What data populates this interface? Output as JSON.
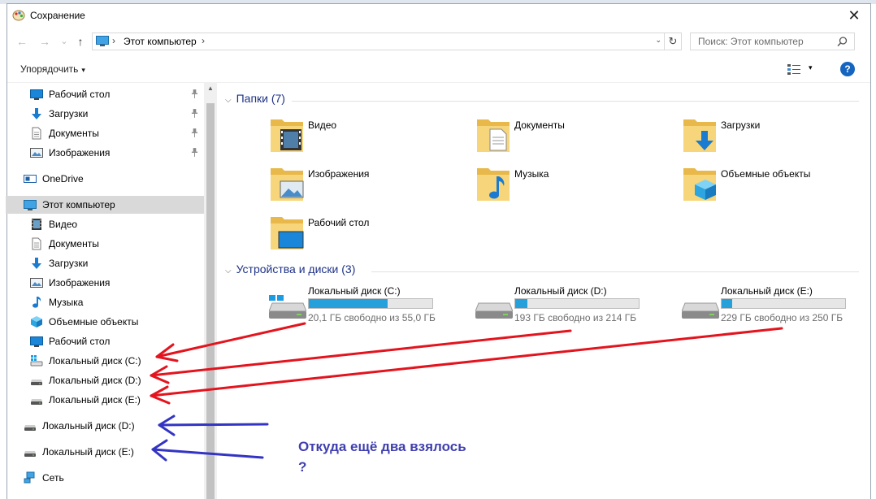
{
  "window": {
    "title": "Сохранение",
    "close_glyph": "✕"
  },
  "nav": {
    "back_glyph": "←",
    "forward_glyph": "→",
    "recent_glyph": "⌄",
    "up_glyph": "↑"
  },
  "address": {
    "location": "Этот компьютер",
    "sep": "›",
    "dropdown_glyph": "⌄",
    "refresh_glyph": "↻"
  },
  "search": {
    "placeholder": "Поиск: Этот компьютер"
  },
  "toolbar": {
    "organize_label": "Упорядочить",
    "caret": "▾",
    "help_label": "?"
  },
  "navpane": {
    "pin_glyph": "📌",
    "items": [
      {
        "label": "Рабочий стол",
        "icon": "desktop-icon"
      },
      {
        "label": "Загрузки",
        "icon": "downloads-icon"
      },
      {
        "label": "Документы",
        "icon": "documents-icon"
      },
      {
        "label": "Изображения",
        "icon": "pictures-icon"
      },
      {
        "label": "OneDrive",
        "icon": "onedrive-icon"
      },
      {
        "label": "Этот компьютер",
        "icon": "this-pc-icon"
      },
      {
        "label": "Видео",
        "icon": "videos-icon"
      },
      {
        "label": "Документы",
        "icon": "documents-icon"
      },
      {
        "label": "Загрузки",
        "icon": "downloads-icon"
      },
      {
        "label": "Изображения",
        "icon": "pictures-icon"
      },
      {
        "label": "Музыка",
        "icon": "music-icon"
      },
      {
        "label": "Объемные объекты",
        "icon": "3d-objects-icon"
      },
      {
        "label": "Рабочий стол",
        "icon": "desktop-icon"
      },
      {
        "label": "Локальный диск (C:)",
        "icon": "windows-drive-icon"
      },
      {
        "label": "Локальный диск (D:)",
        "icon": "drive-icon"
      },
      {
        "label": "Локальный диск (E:)",
        "icon": "drive-icon"
      },
      {
        "label": "Локальный диск (D:)",
        "icon": "drive-icon"
      },
      {
        "label": "Локальный диск (E:)",
        "icon": "drive-icon"
      },
      {
        "label": "Сеть",
        "icon": "network-icon"
      }
    ]
  },
  "content": {
    "folders_header": "Папки (7)",
    "folders": [
      {
        "label": "Видео",
        "icon": "videos-folder-icon"
      },
      {
        "label": "Документы",
        "icon": "documents-folder-icon"
      },
      {
        "label": "Загрузки",
        "icon": "downloads-folder-icon"
      },
      {
        "label": "Изображения",
        "icon": "pictures-folder-icon"
      },
      {
        "label": "Музыка",
        "icon": "music-folder-icon"
      },
      {
        "label": "Объемные объекты",
        "icon": "3d-objects-folder-icon"
      },
      {
        "label": "Рабочий стол",
        "icon": "desktop-folder-icon"
      }
    ],
    "drives_header": "Устройства и диски (3)",
    "drives": [
      {
        "label": "Локальный диск (C:)",
        "status": "20,1 ГБ свободно из 55,0 ГБ",
        "used_fraction": 0.635
      },
      {
        "label": "Локальный диск (D:)",
        "status": "193 ГБ свободно из 214 ГБ",
        "used_fraction": 0.098
      },
      {
        "label": "Локальный диск (E:)",
        "status": "229 ГБ свободно из 250 ГБ",
        "used_fraction": 0.084
      }
    ]
  },
  "annotation": {
    "text_line1": "Откуда ещё два взялось",
    "text_line2": "?",
    "red_color": "#e3141e",
    "blue_color": "#3434c4"
  },
  "colors": {
    "accent": "#26a0da",
    "selected": "#d9d9d9",
    "header_blue": "#1e3287"
  }
}
